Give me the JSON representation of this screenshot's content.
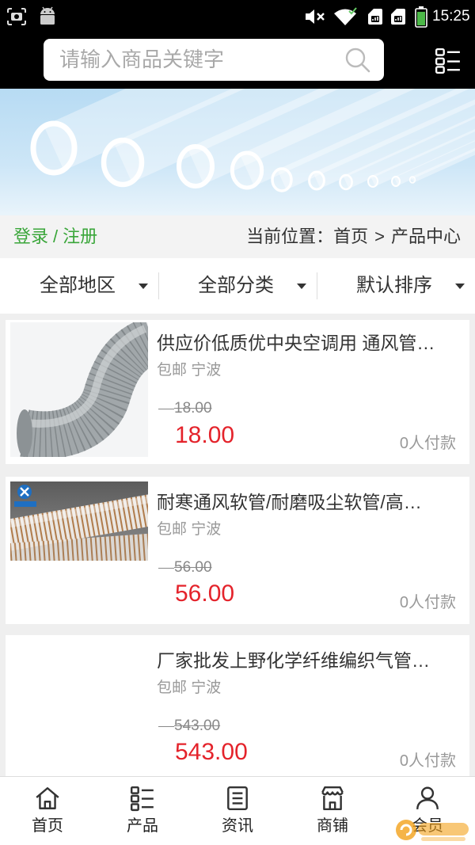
{
  "status_bar": {
    "time": "15:25",
    "left_icons": [
      "screenshot-icon",
      "android-icon"
    ],
    "right_icons": [
      "mute-icon",
      "wifi-icon",
      "sim1-signal-icon",
      "sim2-signal-icon",
      "battery-icon"
    ],
    "battery_level": 0.9
  },
  "header": {
    "search": {
      "placeholder": "请输入商品关键字",
      "value": "",
      "icon": "search-icon"
    },
    "menu_icon": "menu-list-icon"
  },
  "breadcrumb": {
    "login": "登录",
    "separator": "/",
    "register": "注册",
    "location_label": "当前位置：",
    "home": "首页",
    "arrow": ">",
    "current": "产品中心"
  },
  "filters": [
    {
      "label": "全部地区",
      "icon": "caret-down-icon"
    },
    {
      "label": "全部分类",
      "icon": "caret-down-icon"
    },
    {
      "label": "默认排序",
      "icon": "caret-down-icon"
    }
  ],
  "products": [
    {
      "title": "供应价低质优中央空调用 通风管…",
      "meta": "包邮 宁波",
      "original_price": "18.00",
      "price": "18.00",
      "sales": "0人付款"
    },
    {
      "title": "耐寒通风软管/耐磨吸尘软管/高…",
      "meta": "包邮 宁波",
      "original_price": "56.00",
      "price": "56.00",
      "sales": "0人付款"
    },
    {
      "title": "厂家批发上野化学纤维编织气管…",
      "meta": "包邮 宁波",
      "original_price": "543.00",
      "price": "543.00",
      "sales": "0人付款"
    }
  ],
  "bottom_nav": [
    {
      "label": "首页",
      "icon": "home-icon"
    },
    {
      "label": "产品",
      "icon": "product-list-icon"
    },
    {
      "label": "资讯",
      "icon": "news-icon"
    },
    {
      "label": "商铺",
      "icon": "store-icon"
    },
    {
      "label": "会员",
      "icon": "member-icon"
    }
  ],
  "colors": {
    "top_bar": "#000000",
    "login_green": "#3aa63a",
    "price_red": "#e4232b",
    "muted_text": "#999999",
    "page_bg": "#efefef"
  }
}
